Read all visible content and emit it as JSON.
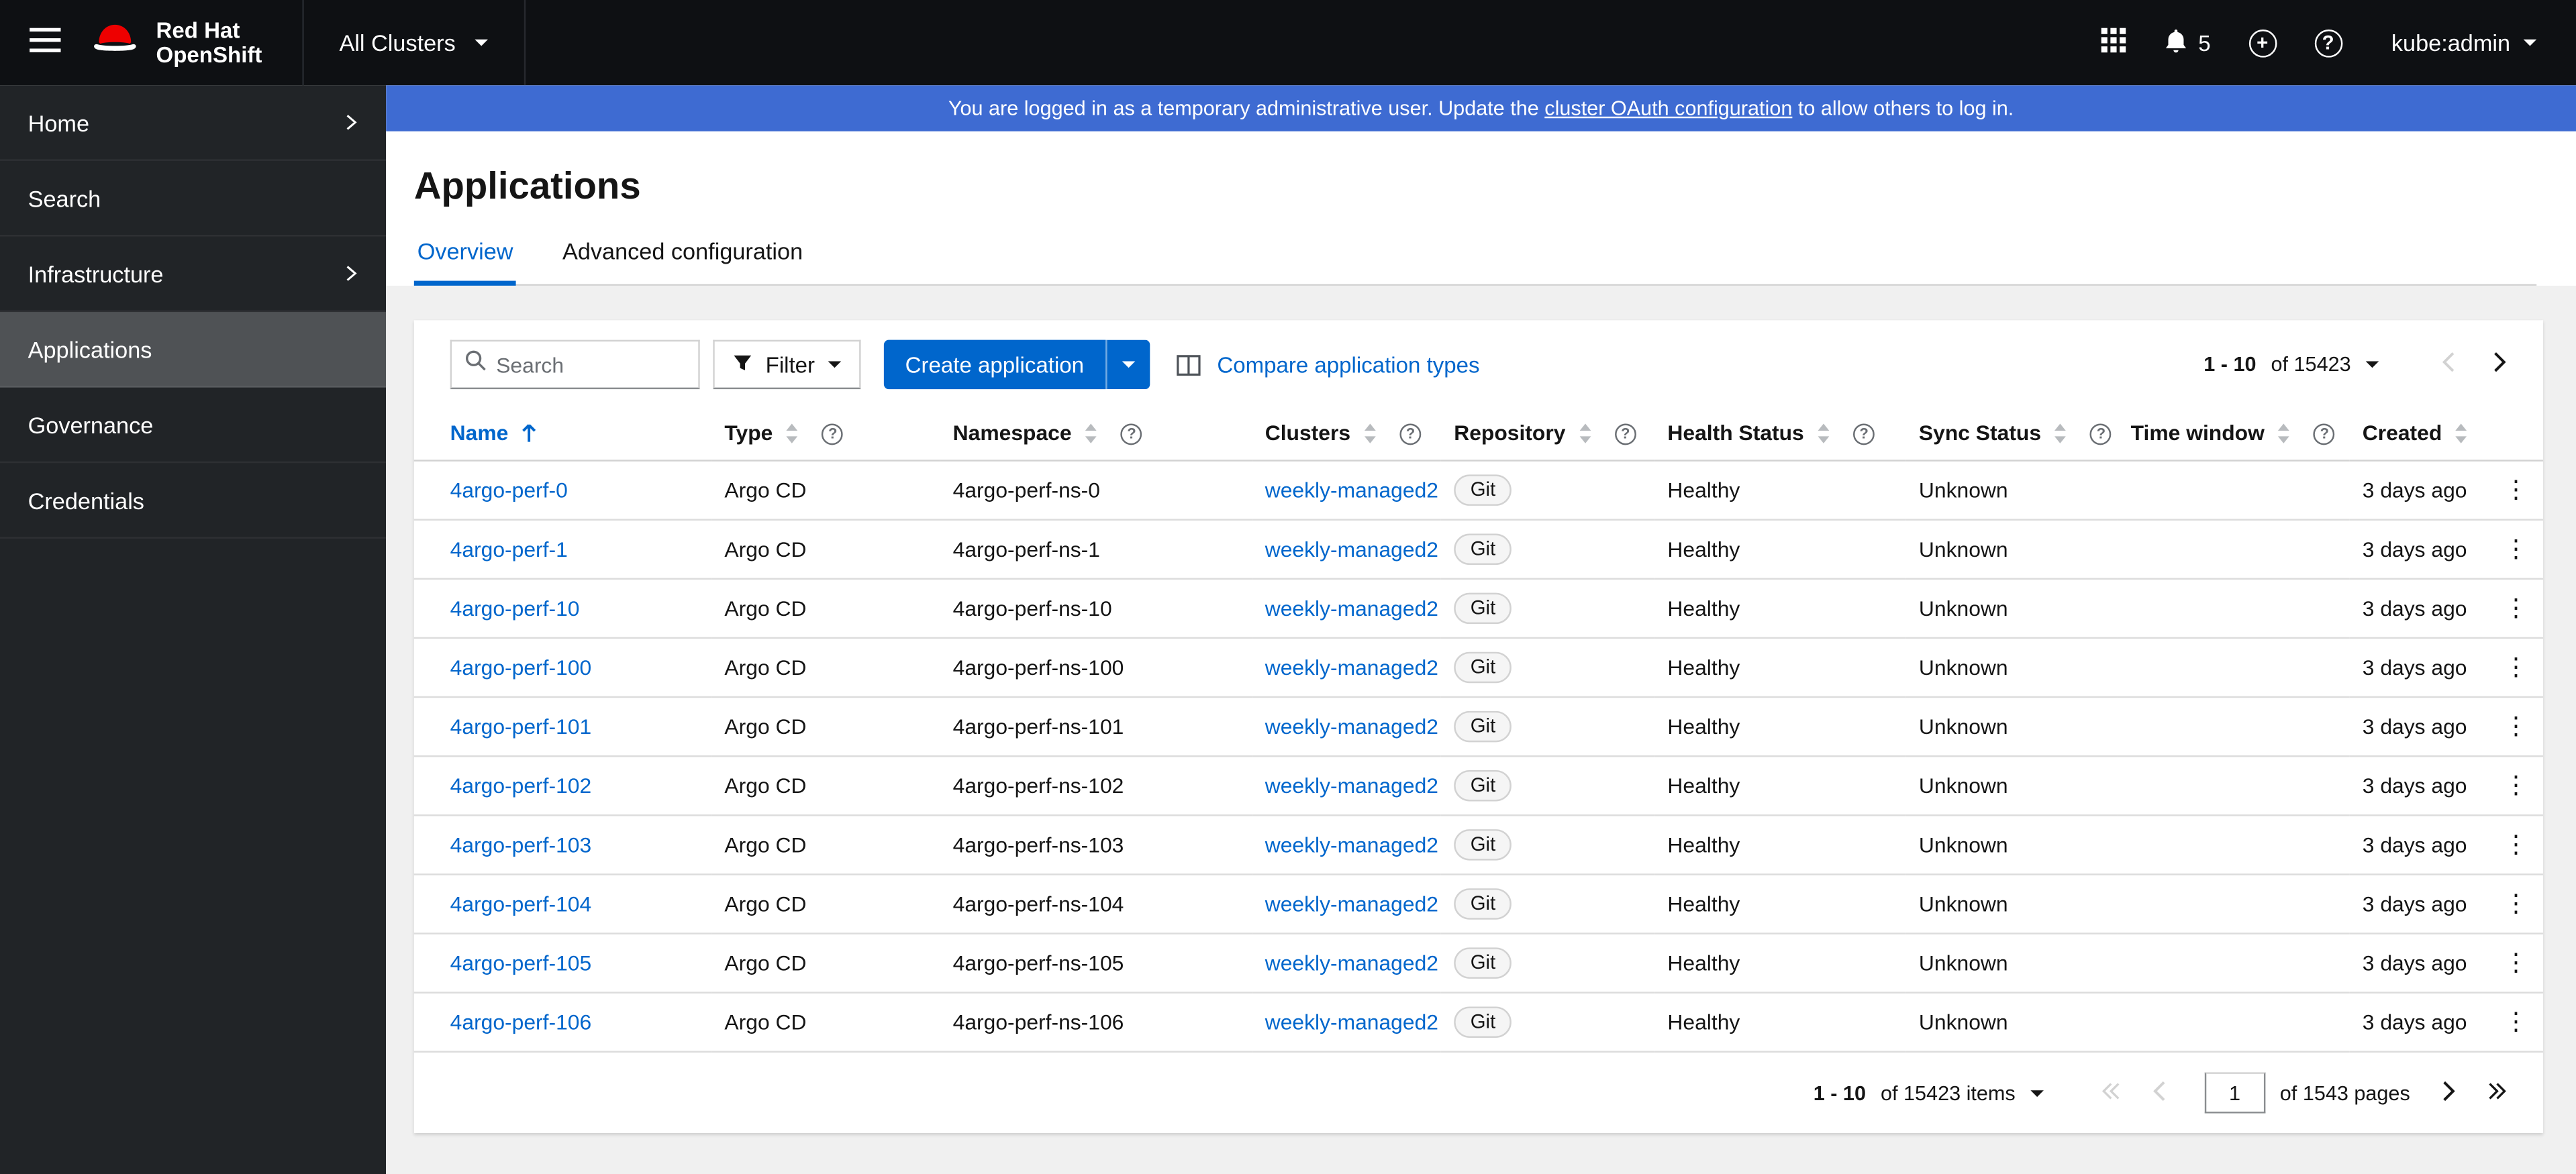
{
  "colors": {
    "accent": "#0066cc",
    "masthead": "#0e1013",
    "sidebar": "#212427",
    "sidebar_selected": "#4f5255",
    "banner": "#3e6bd2",
    "brand_red": "#ee0000",
    "text": "#151515",
    "border": "#d2d2d2",
    "content_bg": "#f0f0f0"
  },
  "header": {
    "brand_line1": "Red Hat",
    "brand_line2": "OpenShift",
    "cluster_selector": "All Clusters",
    "notification_count": "5",
    "user_menu": "kube:admin"
  },
  "banner": {
    "text_before": "You are logged in as a temporary administrative user. Update the ",
    "link": "cluster OAuth configuration",
    "text_after": " to allow others to log in."
  },
  "sidebar": {
    "items": [
      {
        "label": "Home",
        "expandable": true,
        "selected": false
      },
      {
        "label": "Search",
        "expandable": false,
        "selected": false
      },
      {
        "label": "Infrastructure",
        "expandable": true,
        "selected": false
      },
      {
        "label": "Applications",
        "expandable": false,
        "selected": true
      },
      {
        "label": "Governance",
        "expandable": false,
        "selected": false
      },
      {
        "label": "Credentials",
        "expandable": false,
        "selected": false
      }
    ]
  },
  "page": {
    "title": "Applications",
    "tabs": [
      {
        "label": "Overview",
        "active": true
      },
      {
        "label": "Advanced configuration",
        "active": false
      }
    ]
  },
  "toolbar": {
    "search_placeholder": "Search",
    "filter_label": "Filter",
    "create_button": "Create application",
    "compare_link": "Compare application types",
    "pagination_range": "1 - 10",
    "pagination_of": "of 15423"
  },
  "table": {
    "columns": [
      {
        "label": "Name",
        "sorted": "asc",
        "help": false
      },
      {
        "label": "Type",
        "sorted": null,
        "help": true
      },
      {
        "label": "Namespace",
        "sorted": null,
        "help": true
      },
      {
        "label": "Clusters",
        "sorted": null,
        "help": true
      },
      {
        "label": "Repository",
        "sorted": null,
        "help": true
      },
      {
        "label": "Health Status",
        "sorted": null,
        "help": true
      },
      {
        "label": "Sync Status",
        "sorted": null,
        "help": true
      },
      {
        "label": "Time window",
        "sorted": null,
        "help": true
      },
      {
        "label": "Created",
        "sorted": null,
        "help": false
      }
    ],
    "rows": [
      {
        "name": "4argo-perf-0",
        "type": "Argo CD",
        "namespace": "4argo-perf-ns-0",
        "cluster": "weekly-managed2",
        "repository": "Git",
        "health": "Healthy",
        "sync": "Unknown",
        "time_window": "",
        "created": "3 days ago"
      },
      {
        "name": "4argo-perf-1",
        "type": "Argo CD",
        "namespace": "4argo-perf-ns-1",
        "cluster": "weekly-managed2",
        "repository": "Git",
        "health": "Healthy",
        "sync": "Unknown",
        "time_window": "",
        "created": "3 days ago"
      },
      {
        "name": "4argo-perf-10",
        "type": "Argo CD",
        "namespace": "4argo-perf-ns-10",
        "cluster": "weekly-managed2",
        "repository": "Git",
        "health": "Healthy",
        "sync": "Unknown",
        "time_window": "",
        "created": "3 days ago"
      },
      {
        "name": "4argo-perf-100",
        "type": "Argo CD",
        "namespace": "4argo-perf-ns-100",
        "cluster": "weekly-managed2",
        "repository": "Git",
        "health": "Healthy",
        "sync": "Unknown",
        "time_window": "",
        "created": "3 days ago"
      },
      {
        "name": "4argo-perf-101",
        "type": "Argo CD",
        "namespace": "4argo-perf-ns-101",
        "cluster": "weekly-managed2",
        "repository": "Git",
        "health": "Healthy",
        "sync": "Unknown",
        "time_window": "",
        "created": "3 days ago"
      },
      {
        "name": "4argo-perf-102",
        "type": "Argo CD",
        "namespace": "4argo-perf-ns-102",
        "cluster": "weekly-managed2",
        "repository": "Git",
        "health": "Healthy",
        "sync": "Unknown",
        "time_window": "",
        "created": "3 days ago"
      },
      {
        "name": "4argo-perf-103",
        "type": "Argo CD",
        "namespace": "4argo-perf-ns-103",
        "cluster": "weekly-managed2",
        "repository": "Git",
        "health": "Healthy",
        "sync": "Unknown",
        "time_window": "",
        "created": "3 days ago"
      },
      {
        "name": "4argo-perf-104",
        "type": "Argo CD",
        "namespace": "4argo-perf-ns-104",
        "cluster": "weekly-managed2",
        "repository": "Git",
        "health": "Healthy",
        "sync": "Unknown",
        "time_window": "",
        "created": "3 days ago"
      },
      {
        "name": "4argo-perf-105",
        "type": "Argo CD",
        "namespace": "4argo-perf-ns-105",
        "cluster": "weekly-managed2",
        "repository": "Git",
        "health": "Healthy",
        "sync": "Unknown",
        "time_window": "",
        "created": "3 days ago"
      },
      {
        "name": "4argo-perf-106",
        "type": "Argo CD",
        "namespace": "4argo-perf-ns-106",
        "cluster": "weekly-managed2",
        "repository": "Git",
        "health": "Healthy",
        "sync": "Unknown",
        "time_window": "",
        "created": "3 days ago"
      }
    ]
  },
  "pagination": {
    "range": "1 - 10",
    "of_items": "of 15423 items",
    "current_page": "1",
    "of_pages": "of 1543 pages"
  }
}
